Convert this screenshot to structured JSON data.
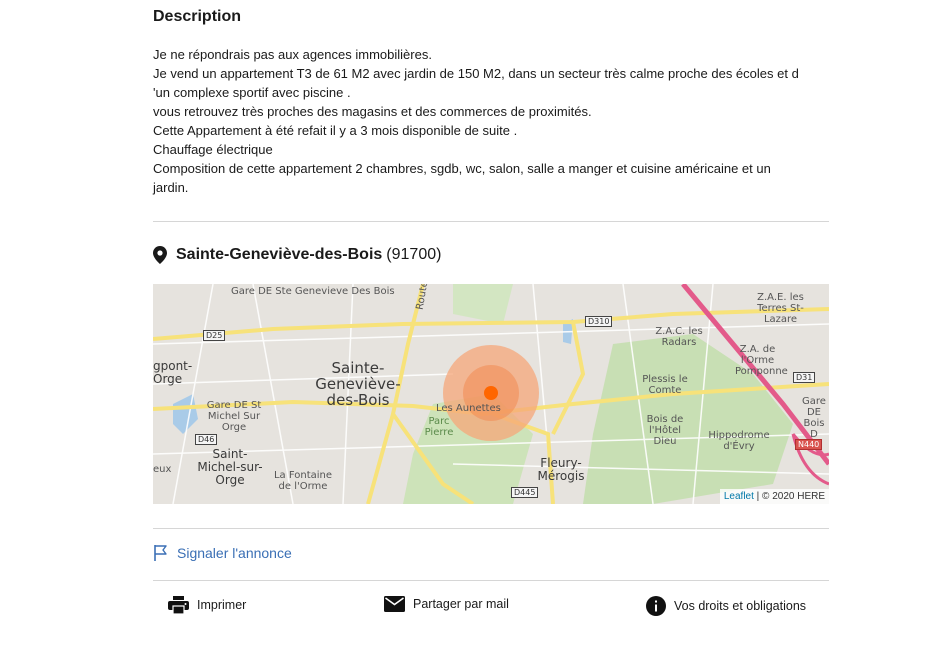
{
  "description": {
    "title": "Description",
    "lines": [
      "Je ne répondrais pas aux agences immobilières.",
      "Je vend un appartement T3 de 61 M2 avec jardin de 150 M2, dans un secteur très calme proche des écoles et d",
      "'un complexe sportif avec piscine .",
      "vous retrouvez très proches des magasins et des commerces de proximités.",
      "Cette Appartement à été refait il y a 3 mois disponible de suite .",
      "Chauffage électrique",
      "Composition de cette appartement 2 chambres, sgdb, wc, salon, salle a manger et cuisine américaine et un",
      "jardin."
    ]
  },
  "location": {
    "icon": "map-pin-icon",
    "city": "Sainte-Geneviève-des-Bois",
    "zip": "(91700)"
  },
  "map": {
    "labels": {
      "gare_ste_genevieve": "Gare DE Ste Genevieve Des Bois",
      "route": "Route",
      "sainte_genevieve": "Sainte-Geneviève-des-Bois",
      "zac_radars": "Z.A.C. les Radars",
      "zae_terres": "Z.A.E. les Terres St-Lazare",
      "za_orme": "Z.A. de l'Orme Pomponne",
      "gare_bois": "Gare DE Bois D",
      "plessis": "Plessis le Comte",
      "bois_hotel_dieu": "Bois de l'Hôtel Dieu",
      "hippodrome": "Hippodrome d'Évry",
      "fleury": "Fleury-Mérogis",
      "aunettes": "Les Aunettes",
      "parc_pierre": "Parc Pierre",
      "saint_michel": "Saint-Michel-sur-Orge",
      "gare_st_michel": "Gare DE St Michel Sur Orge",
      "fontaine": "La Fontaine de l'Orme",
      "gpont": "gpont-Orge",
      "eux": "eux"
    },
    "roads": {
      "d25": "D25",
      "d310": "D310",
      "d31": "D31",
      "d46": "D46",
      "d445": "D445",
      "n440": "N440"
    },
    "attribution": {
      "leaflet": "Leaflet",
      "separator": " | © 2020 HERE"
    },
    "colors": {
      "marker": "#ff6600",
      "circle": "#f5a77a",
      "park": "#c8dfb4",
      "major_road": "#f7e27a",
      "highway": "#e35a8a"
    }
  },
  "report": {
    "icon": "flag-icon",
    "label": "Signaler l'annonce",
    "color": "#3a6fb5"
  },
  "actions": [
    {
      "icon": "printer-icon",
      "label": "Imprimer"
    },
    {
      "icon": "mail-icon",
      "label": "Partager par mail"
    },
    {
      "icon": "info-icon",
      "label": "Vos droits et obligations"
    }
  ]
}
